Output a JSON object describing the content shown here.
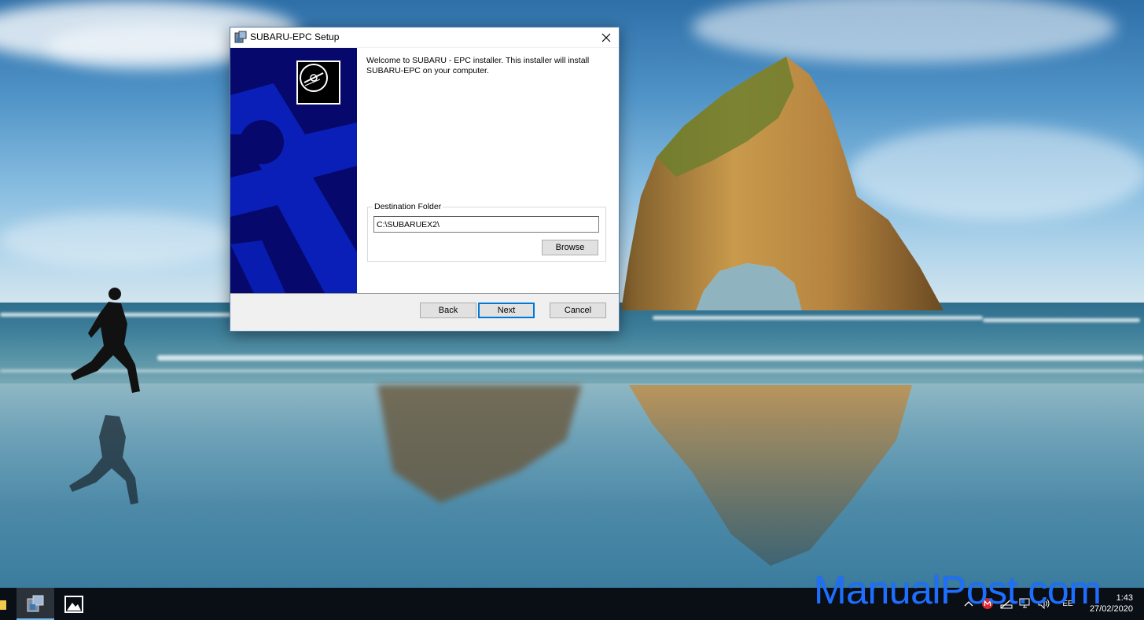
{
  "dialog": {
    "title": "SUBARU-EPC Setup",
    "welcome_text": "Welcome to SUBARU - EPC installer. This installer will install SUBARU-EPC on your computer.",
    "destination": {
      "legend": "Destination Folder",
      "path": "C:\\SUBARUEX2\\",
      "browse_label": "Browse"
    },
    "buttons": {
      "back": "Back",
      "next": "Next",
      "cancel": "Cancel"
    }
  },
  "taskbar": {
    "clock_time": "1:43",
    "clock_date": "27/02/2020",
    "language": "ĖE",
    "pinned": [
      "folder-icon",
      "setup-app-icon",
      "photos-icon"
    ],
    "tray": [
      "chevron-up-icon",
      "mega-icon",
      "network-icon",
      "display-icon",
      "volume-icon"
    ]
  },
  "watermark": "ManualPost.com",
  "colors": {
    "banner": "#06096b",
    "accent": "#0078d7",
    "watermark": "#1e6fff"
  }
}
